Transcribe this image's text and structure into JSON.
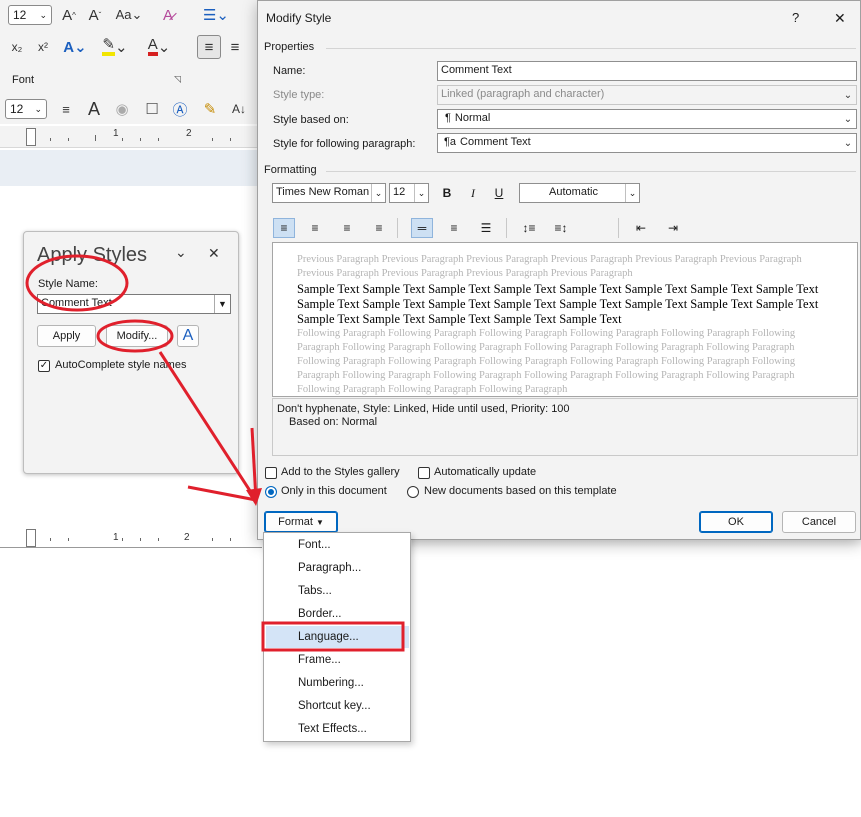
{
  "ribbon": {
    "font_size_top": "12",
    "font_size_bottom": "12",
    "font_group_label": "Font",
    "ruler_numbers_top": [
      "1",
      "2"
    ],
    "ruler_numbers_bottom": [
      "1",
      "2"
    ]
  },
  "apply_styles": {
    "title": "Apply Styles",
    "style_name_label": "Style Name:",
    "style_name_value": "Comment Text",
    "apply_label": "Apply",
    "modify_label": "Modify...",
    "autocomplete_label": "AutoComplete style names",
    "autocomplete_checked": true
  },
  "dialog": {
    "title": "Modify Style",
    "help": "?",
    "close": "✕",
    "properties_label": "Properties",
    "name_label": "Name:",
    "name_value": "Comment Text",
    "style_type_label": "Style type:",
    "style_type_value": "Linked (paragraph and character)",
    "based_on_label": "Style based on:",
    "based_on_value": "Normal",
    "following_label": "Style for following paragraph:",
    "following_value": "Comment Text",
    "formatting_label": "Formatting",
    "font_name": "Times New Roman",
    "font_size": "12",
    "bold": "B",
    "italic": "I",
    "underline": "U",
    "color": "Automatic",
    "preview": {
      "previous": "Previous Paragraph Previous Paragraph Previous Paragraph Previous Paragraph Previous Paragraph Previous Paragraph Previous Paragraph Previous Paragraph Previous Paragraph Previous Paragraph",
      "sample": "Sample Text Sample Text Sample Text Sample Text Sample Text Sample Text Sample Text Sample Text Sample Text Sample Text Sample Text Sample Text Sample Text Sample Text Sample Text Sample Text Sample Text Sample Text Sample Text Sample Text Sample Text",
      "following": "Following Paragraph Following Paragraph Following Paragraph Following Paragraph Following Paragraph Following Paragraph Following Paragraph Following Paragraph Following Paragraph Following Paragraph Following Paragraph Following Paragraph Following Paragraph Following Paragraph Following Paragraph Following Paragraph Following Paragraph Following Paragraph Following Paragraph Following Paragraph Following Paragraph Following Paragraph Following Paragraph Following Paragraph Following Paragraph"
    },
    "description_line1": "Don't hyphenate, Style: Linked, Hide until used, Priority: 100",
    "description_line2": "Based on: Normal",
    "add_gallery_label": "Add to the Styles gallery",
    "auto_update_label": "Automatically update",
    "only_doc_label": "Only in this document",
    "new_docs_label": "New documents based on this template",
    "format_label": "Format",
    "ok_label": "OK",
    "cancel_label": "Cancel"
  },
  "format_menu": {
    "items": [
      "Font...",
      "Paragraph...",
      "Tabs...",
      "Border...",
      "Language...",
      "Frame...",
      "Numbering...",
      "Shortcut key...",
      "Text Effects..."
    ],
    "highlighted": "Language..."
  },
  "annotation_color": "#e0202c"
}
